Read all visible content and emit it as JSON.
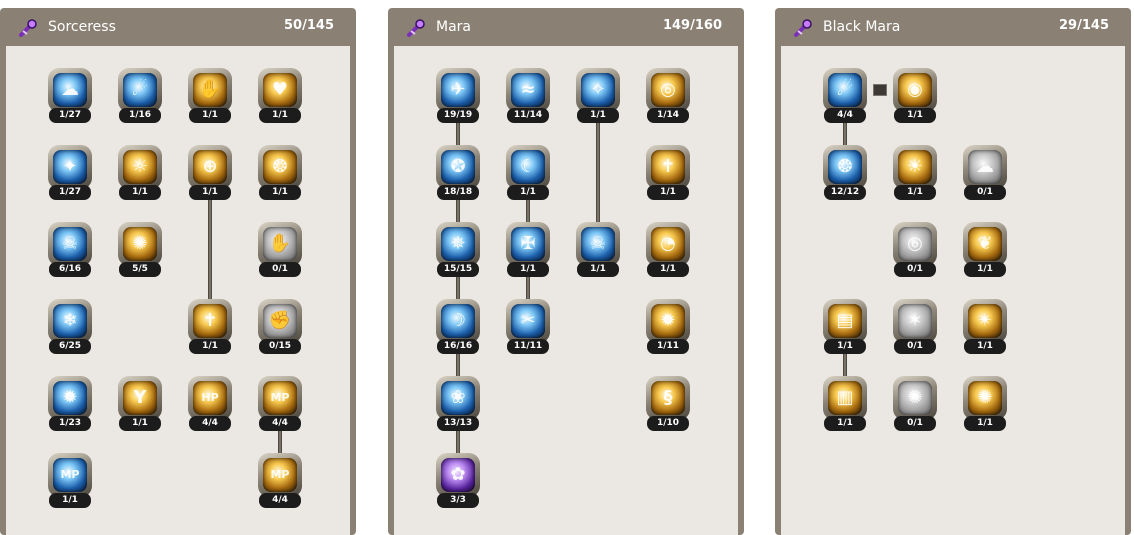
{
  "trees": [
    {
      "name": "Sorceress",
      "points": "50/145",
      "skills": [
        {
          "level": "1/27",
          "color": "blue",
          "glyph": "☁"
        },
        {
          "level": "1/16",
          "color": "blue",
          "glyph": "☄"
        },
        {
          "level": "1/1",
          "color": "gold",
          "glyph": "✋"
        },
        {
          "level": "1/1",
          "color": "gold",
          "glyph": "♥"
        },
        {
          "level": "1/27",
          "color": "blue",
          "glyph": "✦"
        },
        {
          "level": "1/1",
          "color": "gold",
          "glyph": "☼"
        },
        {
          "level": "1/1",
          "color": "gold",
          "glyph": "⊕"
        },
        {
          "level": "1/1",
          "color": "gold",
          "glyph": "❂"
        },
        {
          "level": "6/16",
          "color": "blue",
          "glyph": "☠"
        },
        {
          "level": "5/5",
          "color": "gold",
          "glyph": "✺"
        },
        {
          "level": "0/1",
          "color": "grey",
          "glyph": "✋"
        },
        {
          "level": "6/25",
          "color": "blue",
          "glyph": "❄"
        },
        {
          "level": "1/1",
          "color": "gold",
          "glyph": "✝"
        },
        {
          "level": "0/15",
          "color": "grey",
          "glyph": "✊"
        },
        {
          "level": "1/23",
          "color": "blue",
          "glyph": "✹"
        },
        {
          "level": "1/1",
          "color": "gold",
          "glyph": "Y"
        },
        {
          "level": "4/4",
          "color": "gold",
          "glyph": "HP"
        },
        {
          "level": "4/4",
          "color": "gold",
          "glyph": "MP"
        },
        {
          "level": "1/1",
          "color": "blue",
          "glyph": "MP"
        },
        {
          "level": "4/4",
          "color": "gold",
          "glyph": "MP"
        }
      ]
    },
    {
      "name": "Mara",
      "points": "149/160",
      "skills": [
        {
          "level": "19/19",
          "color": "blue",
          "glyph": "✈"
        },
        {
          "level": "11/14",
          "color": "blue",
          "glyph": "≈"
        },
        {
          "level": "1/1",
          "color": "blue",
          "glyph": "✧"
        },
        {
          "level": "1/14",
          "color": "gold",
          "glyph": "◎"
        },
        {
          "level": "18/18",
          "color": "blue",
          "glyph": "✪"
        },
        {
          "level": "1/1",
          "color": "blue",
          "glyph": "☾"
        },
        {
          "level": "1/1",
          "color": "gold",
          "glyph": "✝"
        },
        {
          "level": "15/15",
          "color": "blue",
          "glyph": "✵"
        },
        {
          "level": "1/1",
          "color": "blue",
          "glyph": "✠"
        },
        {
          "level": "1/1",
          "color": "blue",
          "glyph": "☠"
        },
        {
          "level": "1/1",
          "color": "gold",
          "glyph": "◔"
        },
        {
          "level": "16/16",
          "color": "blue",
          "glyph": "☽"
        },
        {
          "level": "11/11",
          "color": "blue",
          "glyph": "✂"
        },
        {
          "level": "1/11",
          "color": "gold",
          "glyph": "✹"
        },
        {
          "level": "13/13",
          "color": "blue",
          "glyph": "❀"
        },
        {
          "level": "1/10",
          "color": "gold",
          "glyph": "§"
        },
        {
          "level": "3/3",
          "color": "purple",
          "glyph": "✿"
        }
      ]
    },
    {
      "name": "Black Mara",
      "points": "29/145",
      "skills": [
        {
          "level": "4/4",
          "color": "blue",
          "glyph": "☄"
        },
        {
          "level": "1/1",
          "color": "gold",
          "glyph": "◉"
        },
        {
          "level": "12/12",
          "color": "blue",
          "glyph": "❂"
        },
        {
          "level": "1/1",
          "color": "gold",
          "glyph": "☀"
        },
        {
          "level": "0/1",
          "color": "grey",
          "glyph": "☁"
        },
        {
          "level": "0/1",
          "color": "grey",
          "glyph": "◎"
        },
        {
          "level": "1/1",
          "color": "gold",
          "glyph": "❦"
        },
        {
          "level": "1/1",
          "color": "gold",
          "glyph": "▤"
        },
        {
          "level": "0/1",
          "color": "grey",
          "glyph": "✶"
        },
        {
          "level": "1/1",
          "color": "gold",
          "glyph": "✴"
        },
        {
          "level": "1/1",
          "color": "gold",
          "glyph": "▥"
        },
        {
          "level": "0/1",
          "color": "grey",
          "glyph": "✺"
        },
        {
          "level": "1/1",
          "color": "gold",
          "glyph": "✺"
        }
      ]
    }
  ]
}
